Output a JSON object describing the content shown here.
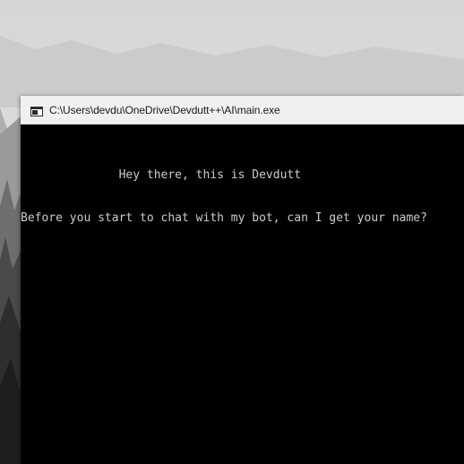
{
  "window": {
    "title": "C:\\Users\\devdu\\OneDrive\\Devdutt++\\AI\\main.exe",
    "icon": "console-app-icon"
  },
  "console": {
    "lines": [
      "              Hey there, this is Devdutt",
      "Before you start to chat with my bot, can I get your name?"
    ],
    "text_color": "#cccccc",
    "background": "#000000"
  },
  "desktop": {
    "wallpaper": "grayscale misty mountain forest"
  }
}
